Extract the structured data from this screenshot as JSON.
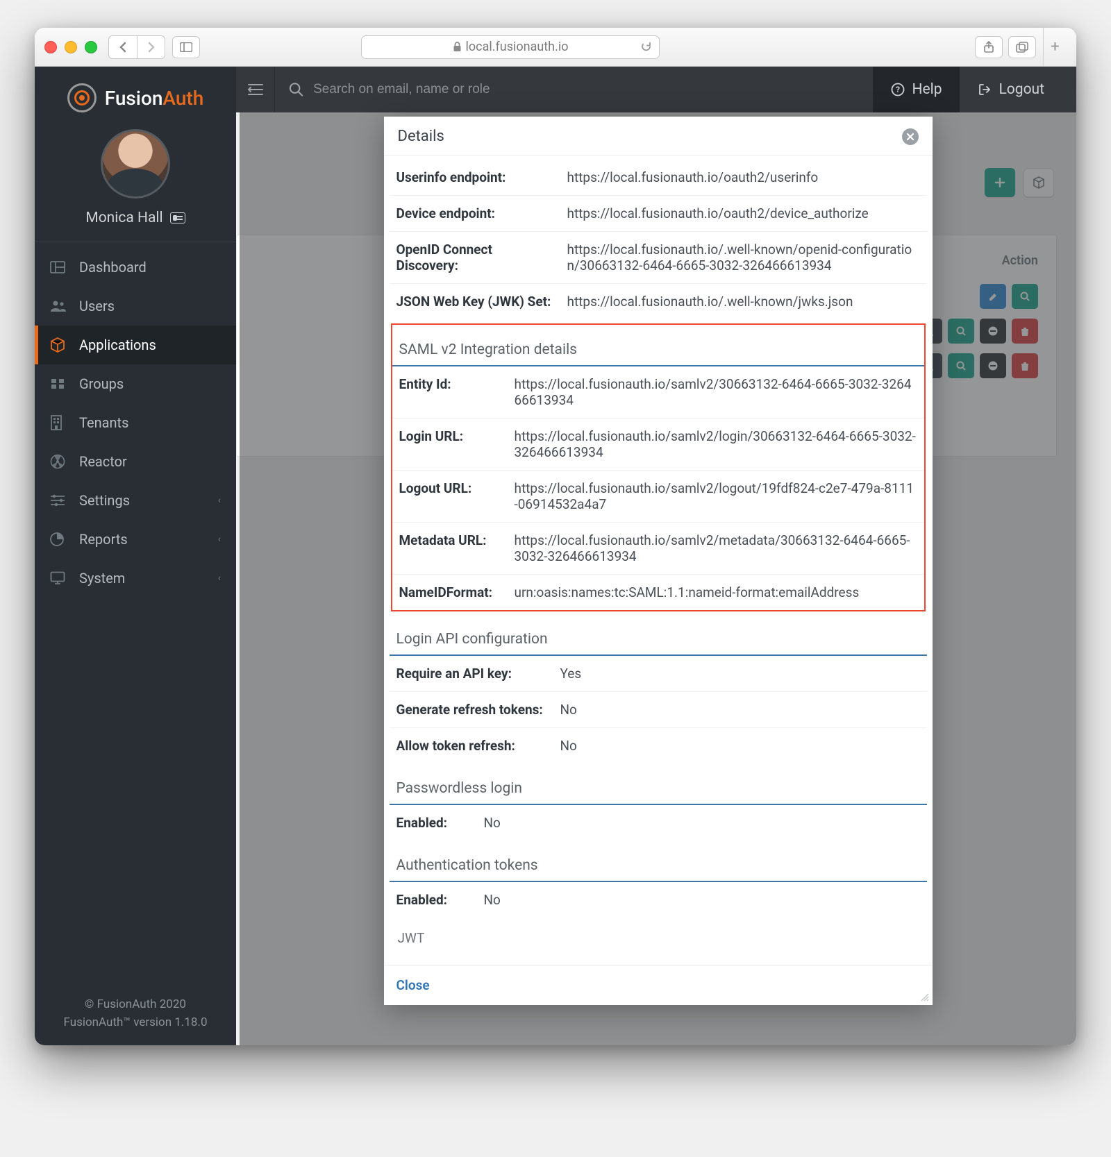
{
  "browser": {
    "url": "local.fusionauth.io"
  },
  "brand": {
    "prefix": "Fusion",
    "suffix": "Auth"
  },
  "user": {
    "name": "Monica Hall"
  },
  "sidebar": {
    "items": [
      {
        "label": "Dashboard",
        "icon": "dashboard"
      },
      {
        "label": "Users",
        "icon": "users"
      },
      {
        "label": "Applications",
        "icon": "cube",
        "active": true
      },
      {
        "label": "Groups",
        "icon": "groups"
      },
      {
        "label": "Tenants",
        "icon": "building"
      },
      {
        "label": "Reactor",
        "icon": "radiation"
      },
      {
        "label": "Settings",
        "icon": "sliders",
        "chevron": true
      },
      {
        "label": "Reports",
        "icon": "pie",
        "chevron": true
      },
      {
        "label": "System",
        "icon": "monitor",
        "chevron": true
      }
    ]
  },
  "footer": {
    "line1": "© FusionAuth 2020",
    "line2": "FusionAuth™ version 1.18.0"
  },
  "topbar": {
    "searchPlaceholder": "Search on email, name or role",
    "help": "Help",
    "logout": "Logout"
  },
  "page": {
    "actionHeader": "Action"
  },
  "modal": {
    "title": "Details",
    "close": "Close",
    "top_rows": [
      {
        "k": "Userinfo endpoint:",
        "v": "https://local.fusionauth.io/oauth2/userinfo"
      },
      {
        "k": "Device endpoint:",
        "v": "https://local.fusionauth.io/oauth2/device_authorize"
      },
      {
        "k": "OpenID Connect Discovery:",
        "v": "https://local.fusionauth.io/.well-known/openid-configuration/30663132-6464-6665-3032-326466613934"
      },
      {
        "k": "JSON Web Key (JWK) Set:",
        "v": "https://local.fusionauth.io/.well-known/jwks.json"
      }
    ],
    "saml_title": "SAML v2 Integration details",
    "saml_rows": [
      {
        "k": "Entity Id:",
        "v": "https://local.fusionauth.io/samlv2/30663132-6464-6665-3032-326466613934"
      },
      {
        "k": "Login URL:",
        "v": "https://local.fusionauth.io/samlv2/login/30663132-6464-6665-3032-326466613934"
      },
      {
        "k": "Logout URL:",
        "v": "https://local.fusionauth.io/samlv2/logout/19fdf824-c2e7-479a-8111-06914532a4a7"
      },
      {
        "k": "Metadata URL:",
        "v": "https://local.fusionauth.io/samlv2/metadata/30663132-6464-6665-3032-326466613934"
      },
      {
        "k": "NameIDFormat:",
        "v": "urn:oasis:names:tc:SAML:1.1:nameid-format:emailAddress"
      }
    ],
    "api_title": "Login API configuration",
    "api_rows": [
      {
        "k": "Require an API key:",
        "v": "Yes"
      },
      {
        "k": "Generate refresh tokens:",
        "v": "No"
      },
      {
        "k": "Allow token refresh:",
        "v": "No"
      }
    ],
    "pwless_title": "Passwordless login",
    "pwless_rows": [
      {
        "k": "Enabled:",
        "v": "No"
      }
    ],
    "auth_title": "Authentication tokens",
    "auth_rows": [
      {
        "k": "Enabled:",
        "v": "No"
      }
    ],
    "jwt_title": "JWT"
  }
}
